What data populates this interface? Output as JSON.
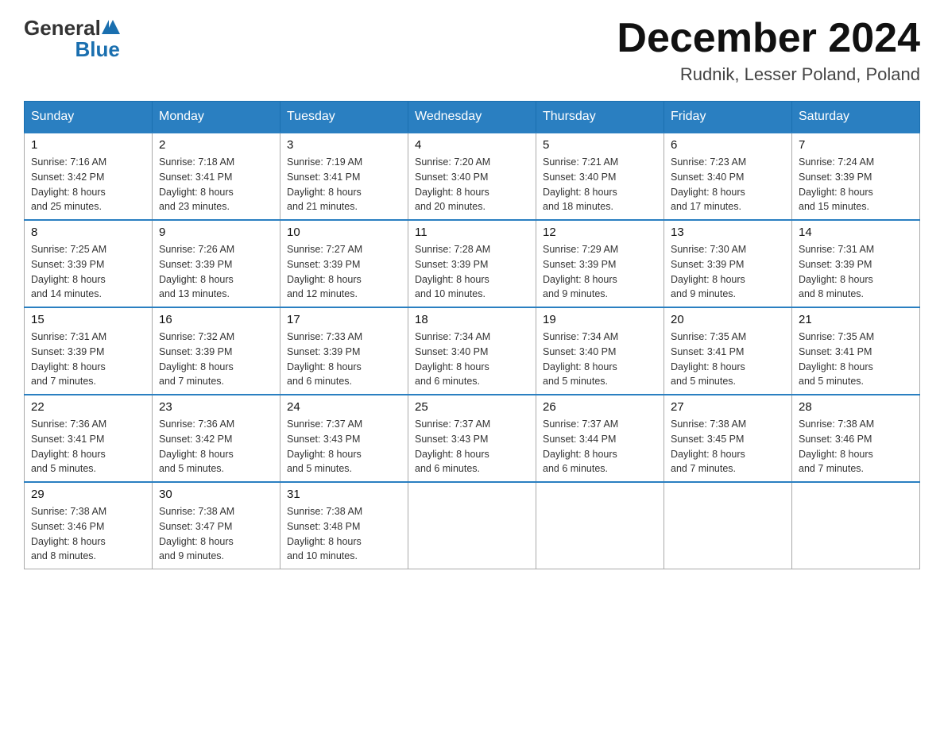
{
  "header": {
    "month_title": "December 2024",
    "subtitle": "Rudnik, Lesser Poland, Poland"
  },
  "days_of_week": [
    "Sunday",
    "Monday",
    "Tuesday",
    "Wednesday",
    "Thursday",
    "Friday",
    "Saturday"
  ],
  "weeks": [
    [
      {
        "day": "1",
        "sunrise": "7:16 AM",
        "sunset": "3:42 PM",
        "daylight": "8 hours and 25 minutes."
      },
      {
        "day": "2",
        "sunrise": "7:18 AM",
        "sunset": "3:41 PM",
        "daylight": "8 hours and 23 minutes."
      },
      {
        "day": "3",
        "sunrise": "7:19 AM",
        "sunset": "3:41 PM",
        "daylight": "8 hours and 21 minutes."
      },
      {
        "day": "4",
        "sunrise": "7:20 AM",
        "sunset": "3:40 PM",
        "daylight": "8 hours and 20 minutes."
      },
      {
        "day": "5",
        "sunrise": "7:21 AM",
        "sunset": "3:40 PM",
        "daylight": "8 hours and 18 minutes."
      },
      {
        "day": "6",
        "sunrise": "7:23 AM",
        "sunset": "3:40 PM",
        "daylight": "8 hours and 17 minutes."
      },
      {
        "day": "7",
        "sunrise": "7:24 AM",
        "sunset": "3:39 PM",
        "daylight": "8 hours and 15 minutes."
      }
    ],
    [
      {
        "day": "8",
        "sunrise": "7:25 AM",
        "sunset": "3:39 PM",
        "daylight": "8 hours and 14 minutes."
      },
      {
        "day": "9",
        "sunrise": "7:26 AM",
        "sunset": "3:39 PM",
        "daylight": "8 hours and 13 minutes."
      },
      {
        "day": "10",
        "sunrise": "7:27 AM",
        "sunset": "3:39 PM",
        "daylight": "8 hours and 12 minutes."
      },
      {
        "day": "11",
        "sunrise": "7:28 AM",
        "sunset": "3:39 PM",
        "daylight": "8 hours and 10 minutes."
      },
      {
        "day": "12",
        "sunrise": "7:29 AM",
        "sunset": "3:39 PM",
        "daylight": "8 hours and 9 minutes."
      },
      {
        "day": "13",
        "sunrise": "7:30 AM",
        "sunset": "3:39 PM",
        "daylight": "8 hours and 9 minutes."
      },
      {
        "day": "14",
        "sunrise": "7:31 AM",
        "sunset": "3:39 PM",
        "daylight": "8 hours and 8 minutes."
      }
    ],
    [
      {
        "day": "15",
        "sunrise": "7:31 AM",
        "sunset": "3:39 PM",
        "daylight": "8 hours and 7 minutes."
      },
      {
        "day": "16",
        "sunrise": "7:32 AM",
        "sunset": "3:39 PM",
        "daylight": "8 hours and 7 minutes."
      },
      {
        "day": "17",
        "sunrise": "7:33 AM",
        "sunset": "3:39 PM",
        "daylight": "8 hours and 6 minutes."
      },
      {
        "day": "18",
        "sunrise": "7:34 AM",
        "sunset": "3:40 PM",
        "daylight": "8 hours and 6 minutes."
      },
      {
        "day": "19",
        "sunrise": "7:34 AM",
        "sunset": "3:40 PM",
        "daylight": "8 hours and 5 minutes."
      },
      {
        "day": "20",
        "sunrise": "7:35 AM",
        "sunset": "3:41 PM",
        "daylight": "8 hours and 5 minutes."
      },
      {
        "day": "21",
        "sunrise": "7:35 AM",
        "sunset": "3:41 PM",
        "daylight": "8 hours and 5 minutes."
      }
    ],
    [
      {
        "day": "22",
        "sunrise": "7:36 AM",
        "sunset": "3:41 PM",
        "daylight": "8 hours and 5 minutes."
      },
      {
        "day": "23",
        "sunrise": "7:36 AM",
        "sunset": "3:42 PM",
        "daylight": "8 hours and 5 minutes."
      },
      {
        "day": "24",
        "sunrise": "7:37 AM",
        "sunset": "3:43 PM",
        "daylight": "8 hours and 5 minutes."
      },
      {
        "day": "25",
        "sunrise": "7:37 AM",
        "sunset": "3:43 PM",
        "daylight": "8 hours and 6 minutes."
      },
      {
        "day": "26",
        "sunrise": "7:37 AM",
        "sunset": "3:44 PM",
        "daylight": "8 hours and 6 minutes."
      },
      {
        "day": "27",
        "sunrise": "7:38 AM",
        "sunset": "3:45 PM",
        "daylight": "8 hours and 7 minutes."
      },
      {
        "day": "28",
        "sunrise": "7:38 AM",
        "sunset": "3:46 PM",
        "daylight": "8 hours and 7 minutes."
      }
    ],
    [
      {
        "day": "29",
        "sunrise": "7:38 AM",
        "sunset": "3:46 PM",
        "daylight": "8 hours and 8 minutes."
      },
      {
        "day": "30",
        "sunrise": "7:38 AM",
        "sunset": "3:47 PM",
        "daylight": "8 hours and 9 minutes."
      },
      {
        "day": "31",
        "sunrise": "7:38 AM",
        "sunset": "3:48 PM",
        "daylight": "8 hours and 10 minutes."
      },
      null,
      null,
      null,
      null
    ]
  ],
  "labels": {
    "sunrise": "Sunrise:",
    "sunset": "Sunset:",
    "daylight": "Daylight:"
  }
}
